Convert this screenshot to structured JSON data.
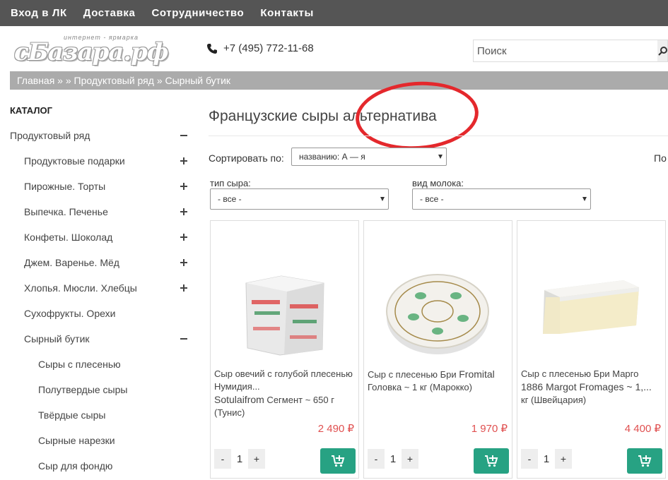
{
  "topnav": [
    "Вход в ЛК",
    "Доставка",
    "Сотрудничество",
    "Контакты"
  ],
  "logo": {
    "small": "интернет - ярмарка",
    "main": "сБазара.рф"
  },
  "phone": "+7 (495) 772-11-68",
  "search": {
    "placeholder": "Поиск"
  },
  "breadcrumb": "Главная » » Продуктовый ряд » Сырный бутик",
  "sidebar": {
    "title": "КАТАЛОГ",
    "items": [
      {
        "label": "Продуктовый ряд",
        "toggle": "minus",
        "level": 0
      },
      {
        "label": "Продуктовые подарки",
        "toggle": "plus",
        "level": 1
      },
      {
        "label": "Пирожные. Торты",
        "toggle": "plus",
        "level": 1
      },
      {
        "label": "Выпечка. Печенье",
        "toggle": "plus",
        "level": 1
      },
      {
        "label": "Конфеты. Шоколад",
        "toggle": "plus",
        "level": 1
      },
      {
        "label": "Джем. Варенье. Мёд",
        "toggle": "plus",
        "level": 1
      },
      {
        "label": "Хлопья. Мюсли. Хлебцы",
        "toggle": "plus",
        "level": 1
      },
      {
        "label": "Сухофрукты. Орехи",
        "toggle": "",
        "level": 1
      },
      {
        "label": "Сырный бутик",
        "toggle": "minus",
        "level": 1
      },
      {
        "label": "Сыры с плесенью",
        "toggle": "",
        "level": 2
      },
      {
        "label": "Полутвердые сыры",
        "toggle": "",
        "level": 2
      },
      {
        "label": "Твёрдые сыры",
        "toggle": "",
        "level": 2
      },
      {
        "label": "Сырные нарезки",
        "toggle": "",
        "level": 2
      },
      {
        "label": "Сыр для фондю",
        "toggle": "",
        "level": 2
      }
    ]
  },
  "main": {
    "title": "Французские сыры альтернатива",
    "sort_label": "Сортировать по:",
    "sort_value": "названию: А — я",
    "right_cut": "По",
    "filters": [
      {
        "label": "тип сыра:",
        "value": "- все -"
      },
      {
        "label": "вид молока:",
        "value": "- все -"
      }
    ]
  },
  "products": [
    {
      "name_small": "Сыр овечий с голубой плесенью Нумидия...",
      "name_big": "Sotulaifrom",
      "name_tail": " Сегмент ~ 650 г (Тунис)",
      "price": "2 490 ₽",
      "qty": "1"
    },
    {
      "name_small": "Сыр с плесенью Бри ",
      "name_big": "Fromital",
      "name_tail": " Головка ~ 1 кг (Марокко)",
      "price": "1 970 ₽",
      "qty": "1"
    },
    {
      "name_small": "Сыр с плесенью Бри Марго ",
      "name_big": "1886 Margot Fromages ~ 1,...",
      "name_tail": " кг (Швейцария)",
      "price": "4 400 ₽",
      "qty": "1"
    }
  ],
  "qty_minus": "-",
  "qty_plus": "+",
  "colors": {
    "nav": "#555555",
    "accent": "#27a283",
    "price": "#e05050",
    "highlight": "#e4282c"
  }
}
